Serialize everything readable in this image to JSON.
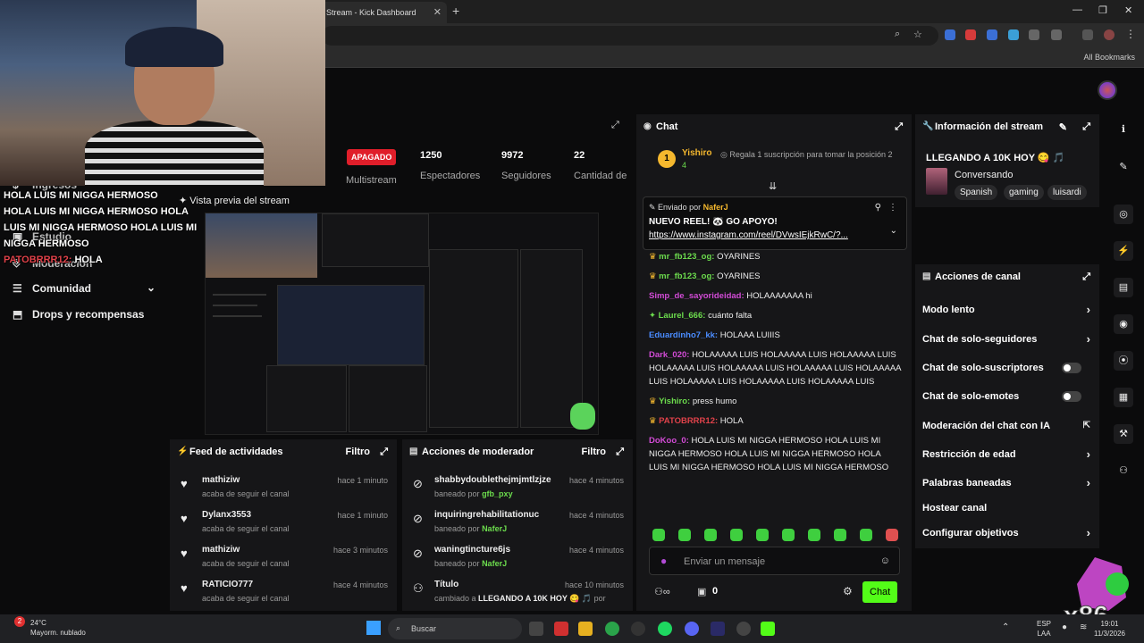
{
  "browser": {
    "tab_title": "Stream - Kick Dashboard",
    "new_tab": "+",
    "bookmarks": "All Bookmarks",
    "min": "—",
    "max": "❐",
    "close": "✕"
  },
  "nav": {
    "items": [
      {
        "label": "Ingresos"
      },
      {
        "label": "Estudio"
      },
      {
        "label": "Moderación"
      },
      {
        "label": "Comunidad"
      },
      {
        "label": "Drops y recompensas"
      }
    ]
  },
  "overlay_chat": {
    "lines": [
      "HOLA LUIS MI NIGGA HERMOSO",
      "HOLA LUIS MI NIGGA HERMOSO   HOLA",
      "LUIS MI NIGGA HERMOSO   HOLA LUIS MI",
      "NIGGA HERMOSO"
    ],
    "last_user": "PATOBRRR12:",
    "last_text": "HOLA"
  },
  "stats": {
    "status": "APAGADO",
    "status_label": "Multistream",
    "viewers": "1250",
    "viewers_label": "Espectadores",
    "followers": "9972",
    "followers_label": "Seguidores",
    "subs": "22",
    "subs_label": "Cantidad de"
  },
  "preview": {
    "title": "Vista previa del stream"
  },
  "feed": {
    "title": "Feed de actividades",
    "filter": "Filtro",
    "rows": [
      {
        "user": "mathiziw",
        "sub": "acaba de seguir el canal",
        "time": "hace 1 minuto"
      },
      {
        "user": "Dylanx3553",
        "sub": "acaba de seguir el canal",
        "time": "hace 1 minuto"
      },
      {
        "user": "mathiziw",
        "sub": "acaba de seguir el canal",
        "time": "hace 3 minutos"
      },
      {
        "user": "RATICIO777",
        "sub": "acaba de seguir el canal",
        "time": "hace 4 minutos"
      }
    ]
  },
  "mod": {
    "title": "Acciones de moderador",
    "filter": "Filtro",
    "rows": [
      {
        "user": "shabbydoublethejmjmtlzjze",
        "action": "baneado por",
        "by": "gfb_pxy",
        "time": "hace 4 minutos"
      },
      {
        "user": "inquiringrehabilitationuc",
        "action": "baneado por",
        "by": "NaferJ",
        "time": "hace 4 minutos"
      },
      {
        "user": "waningtincture6js",
        "action": "baneado por",
        "by": "NaferJ",
        "time": "hace 4 minutos"
      },
      {
        "user": "Título",
        "action": "cambiado a",
        "by": "LLEGANDO A 10K HOY 😋 🎵",
        "by2": "por",
        "time": "hace 10 minutos"
      }
    ]
  },
  "chat": {
    "title": "Chat",
    "gifter": "Yishiro",
    "gifter_rank": "1",
    "gifter_count": "4",
    "gift_prompt": "Regala 1 suscripción para tomar la posición 2",
    "pinned_by_label": "Enviado por",
    "pinned_by": "NaferJ",
    "pinned_text": "NUEVO REEL! 🐼 GO APOYO!",
    "pinned_link": "https://www.instagram.com/reel/DVwsIEjkRwC/?...",
    "messages": [
      {
        "user": "mr_fb123_og:",
        "text": "OYARINES",
        "color": "#6cdc4d"
      },
      {
        "user": "mr_fb123_og:",
        "text": "OYARINES",
        "color": "#6cdc4d"
      },
      {
        "user": "Simp_de_sayorideidad:",
        "text": "HOLAAAAAAA hi",
        "color": "#d24bd6"
      },
      {
        "user": "Laurel_666:",
        "text": "cuánto falta",
        "color": "#6cdc4d"
      },
      {
        "user": "Eduardinho7_kk:",
        "text": "HOLAAA LUIIIS",
        "color": "#4a8cff"
      },
      {
        "user": "Dark_020:",
        "text": "HOLAAAAA LUIS HOLAAAAA LUIS HOLAAAAA LUIS HOLAAAAA LUIS HOLAAAAA LUIS HOLAAAAA LUIS HOLAAAAA LUIS HOLAAAAA LUIS HOLAAAAA LUIS HOLAAAAA LUIS",
        "color": "#d24bd6"
      },
      {
        "user": "Yishiro:",
        "text": "press humo",
        "color": "#6cdc4d"
      },
      {
        "user": "PATOBRRR12:",
        "text": "HOLA",
        "color": "#e0424a"
      },
      {
        "user": "DoKoo_0:",
        "text": "HOLA LUIS MI NIGGA HERMOSO   HOLA LUIS MI NIGGA HERMOSO   HOLA LUIS MI NIGGA HERMOSO   HOLA LUIS MI NIGGA HERMOSO   HOLA LUIS MI NIGGA HERMOSO",
        "color": "#d24bd6"
      }
    ],
    "input_placeholder": "Enviar un mensaje",
    "points": "0",
    "send": "Chat"
  },
  "info": {
    "title": "Información del stream",
    "stream_title": "LLEGANDO A 10K HOY 😋 🎵",
    "category": "Conversando",
    "tags": [
      "Spanish",
      "gaming",
      "luisardi"
    ]
  },
  "canal": {
    "title": "Acciones de canal",
    "items": [
      {
        "label": "Modo lento",
        "kind": "chevron"
      },
      {
        "label": "Chat de solo-seguidores",
        "kind": "chevron"
      },
      {
        "label": "Chat de solo-suscriptores",
        "kind": "toggle"
      },
      {
        "label": "Chat de solo-emotes",
        "kind": "toggle"
      },
      {
        "label": "Moderación del chat con IA",
        "kind": "external"
      },
      {
        "label": "Restricción de edad",
        "kind": "chevron"
      },
      {
        "label": "Palabras baneadas",
        "kind": "chevron"
      },
      {
        "label": "Hostear canal",
        "kind": "none"
      },
      {
        "label": "Configurar objetivos",
        "kind": "chevron"
      }
    ]
  },
  "watermark": "x86",
  "taskbar": {
    "temp": "24°C",
    "weather": "Mayorm. nublado",
    "search": "Buscar",
    "lang": "ESP",
    "lang2": "LAA",
    "time": "19:01",
    "date": "11/3/2026",
    "weather_badge": "2"
  }
}
